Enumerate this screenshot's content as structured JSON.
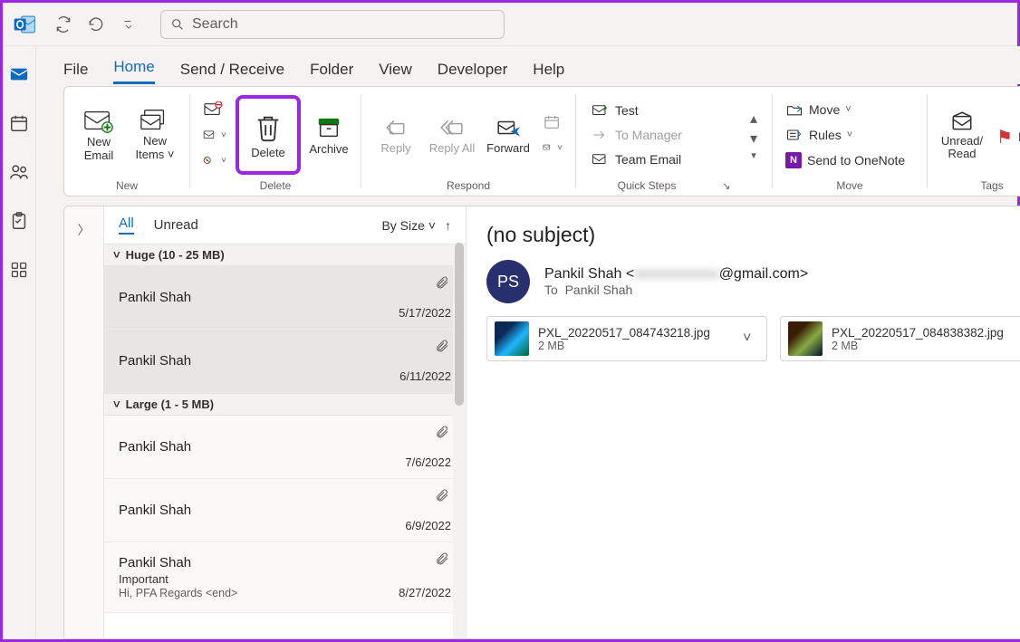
{
  "title_search_placeholder": "Search",
  "tabs": [
    "File",
    "Home",
    "Send / Receive",
    "Folder",
    "View",
    "Developer",
    "Help"
  ],
  "active_tab": "Home",
  "ribbon": {
    "new_email": "New Email",
    "new_items": "New Items",
    "delete": "Delete",
    "archive": "Archive",
    "reply": "Reply",
    "reply_all": "Reply All",
    "forward": "Forward",
    "quick_steps": {
      "test": "Test",
      "to_manager": "To Manager",
      "team_email": "Team Email"
    },
    "move": "Move",
    "rules": "Rules",
    "onenote": "Send to OneNote",
    "unread_read": "Unread/\nRead",
    "follow": "Follo",
    "group_new": "New",
    "group_delete": "Delete",
    "group_respond": "Respond",
    "group_quick": "Quick Steps",
    "group_move": "Move",
    "group_tags": "Tags"
  },
  "list": {
    "filter_all": "All",
    "filter_unread": "Unread",
    "sort_by": "By Size",
    "groups": [
      {
        "label": "Huge (10 - 25 MB)",
        "items": [
          {
            "sender": "Pankil Shah",
            "date": "5/17/2022",
            "has_attachment": true,
            "selected": true
          },
          {
            "sender": "Pankil Shah",
            "date": "6/11/2022",
            "has_attachment": true,
            "selected": true
          }
        ]
      },
      {
        "label": "Large (1 - 5 MB)",
        "items": [
          {
            "sender": "Pankil Shah",
            "date": "7/6/2022",
            "has_attachment": true
          },
          {
            "sender": "Pankil Shah",
            "date": "6/9/2022",
            "has_attachment": true
          },
          {
            "sender": "Pankil Shah",
            "subject": "Important",
            "preview": "Hi,  PFA  Regards  <end>",
            "date": "8/27/2022",
            "has_attachment": true
          }
        ]
      }
    ]
  },
  "read": {
    "subject": "(no subject)",
    "avatar_initials": "PS",
    "from_name": "Pankil Shah",
    "from_domain": "@gmail.com",
    "to_label": "To",
    "to_name": "Pankil Shah",
    "attachments": [
      {
        "name": "PXL_20220517_084743218.jpg",
        "size": "2 MB",
        "has_dropdown": true
      },
      {
        "name": "PXL_20220517_084838382.jpg",
        "size": "2 MB",
        "has_dropdown": false
      }
    ]
  }
}
